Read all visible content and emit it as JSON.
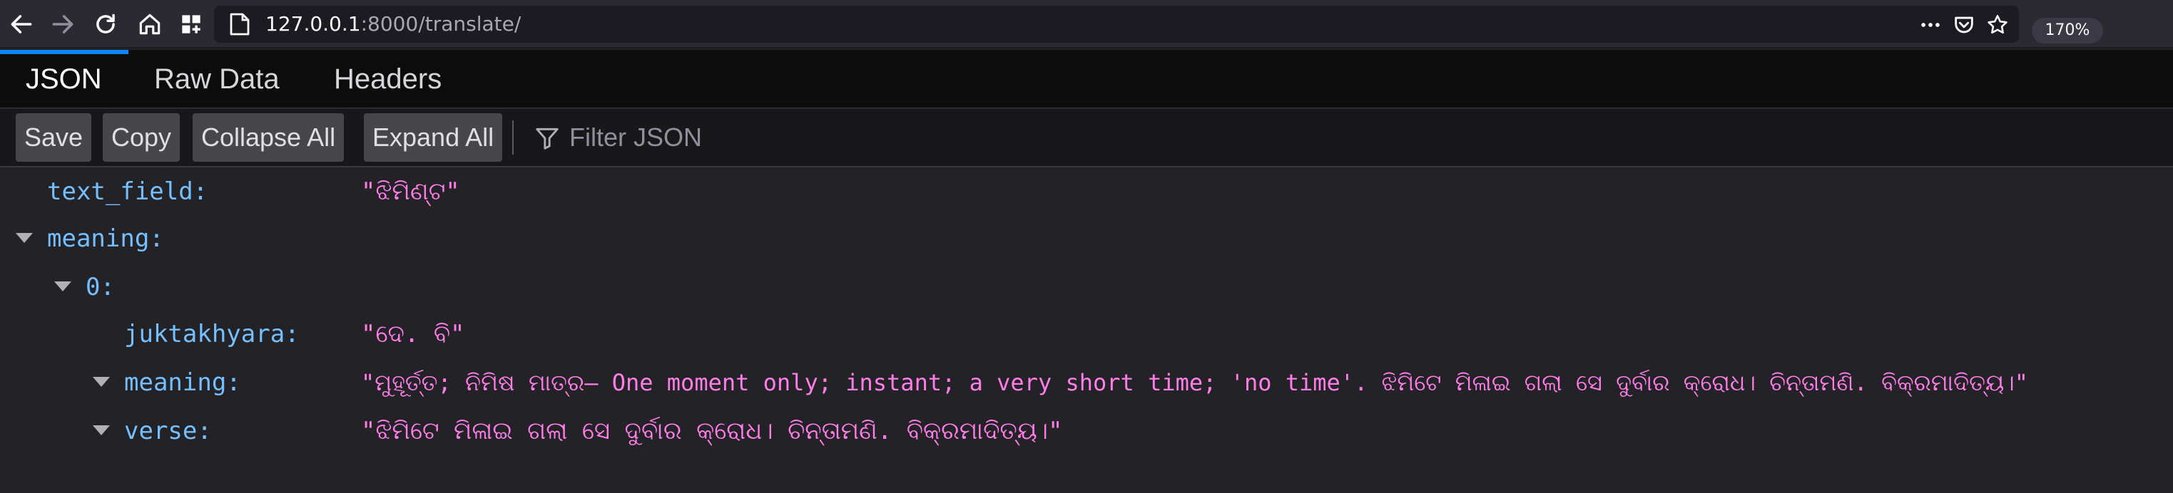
{
  "browser": {
    "url_host": "127.0.0.1",
    "url_rest": ":8000/translate/",
    "zoom": "170%"
  },
  "tabs": [
    {
      "label": "JSON",
      "selected": true
    },
    {
      "label": "Raw Data",
      "selected": false
    },
    {
      "label": "Headers",
      "selected": false
    }
  ],
  "toolbar": {
    "save": "Save",
    "copy": "Copy",
    "collapse_all": "Collapse All",
    "expand_all": "Expand All",
    "filter_placeholder": "Filter JSON"
  },
  "json_tree": {
    "text_field": {
      "key": "text_field:",
      "value": "\"ଝିମିଣ୍ଟ\""
    },
    "meaning": {
      "key": "meaning:"
    },
    "item0": {
      "key": "0:"
    },
    "juktakhyara": {
      "key": "juktakhyara:",
      "value": "\"ଦେ. ବି\""
    },
    "meaning_inner": {
      "key": "meaning:",
      "value": "\"ମୁହୂର୍ତ୍ତ; ନିମିଷ ମାତ୍ର— One moment only; instant; a very short time; 'no time'. ଝିମିଟେ ମିଳାଇ ଗଲା ସେ ଦୁର୍ବାର କ୍ରୋଧ। ଚିନ୍ତାମଣି. ବିକ୍ରମାଦିତ୍ୟ।\""
    },
    "verse": {
      "key": "verse:",
      "value": "\"ଝିମିଟେ ମିଳାଇ ଗଲା ସେ ଦୁର୍ବାର କ୍ରୋଧ। ଚିନ୍ତାମଣି. ବିକ୍ରମାଦିତ୍ୟ।\""
    }
  },
  "colors": {
    "key": "#75bfff",
    "string_value": "#ff7de9",
    "tab_accent": "#0a84ff"
  },
  "icons": [
    "back-arrow-icon",
    "forward-arrow-icon",
    "reload-icon",
    "home-icon",
    "extensions-icon",
    "page-icon",
    "more-icon",
    "pocket-icon",
    "bookmark-star-icon",
    "filter-icon",
    "twisty-icon"
  ]
}
